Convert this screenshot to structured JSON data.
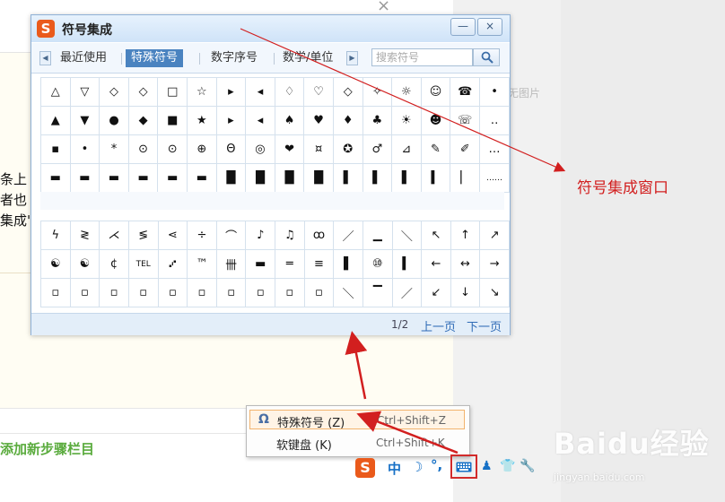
{
  "background": {
    "lines": [
      "条上",
      "者也",
      "集成\""
    ],
    "no_image": "无图片",
    "add_step": "添加新步骤栏目",
    "close_glyph": "×"
  },
  "window": {
    "title": "符号集成",
    "logo_glyph": "S",
    "minimize_glyph": "—",
    "close_glyph": "×",
    "tabs": [
      "最近使用",
      "特殊符号",
      "数字序号",
      "数学/单位"
    ],
    "active_tab": "特殊符号",
    "search_placeholder": "搜索符号",
    "grid_a": [
      [
        "△",
        "▽",
        "◇",
        "◇",
        "□",
        "☆",
        "▸",
        "◂",
        "♢",
        "♡",
        "◇",
        "✧",
        "☼",
        "☺",
        "☎",
        "•"
      ],
      [
        "▲",
        "▼",
        "●",
        "◆",
        "■",
        "★",
        "▸",
        "◂",
        "♠",
        "♥",
        "♦",
        "♣",
        "☀",
        "☻",
        "☏",
        "‥"
      ],
      [
        "▪",
        "•",
        "*",
        "⊙",
        "⊙",
        "⊕",
        "Θ",
        "◎",
        "❤",
        "¤",
        "✪",
        "♂",
        "⊿",
        "✎",
        "✐",
        "…"
      ],
      [
        "▬",
        "▬",
        "▬",
        "▬",
        "▬",
        "▬",
        "█",
        "█",
        "█",
        "█",
        "▌",
        "▌",
        "▌",
        "▍",
        "▏",
        "……"
      ]
    ],
    "grid_b": [
      [
        "ϟ",
        "≷",
        "⋌",
        "≶",
        "⋖",
        "÷",
        "⌒",
        "♪",
        "♫",
        "ꝏ",
        "／",
        "▁",
        "＼",
        "↖",
        "↑",
        "↗"
      ],
      [
        "☯",
        "☯",
        "¢",
        "TEL",
        "⑇",
        "™",
        "卌",
        "▬",
        "═",
        "≡",
        "▌",
        "⑩",
        "▍",
        "←",
        "↔",
        "→"
      ],
      [
        "▫",
        "▫",
        "▫",
        "▫",
        "▫",
        "▫",
        "▫",
        "▫",
        "▫",
        "▫",
        "＼",
        "▔",
        "／",
        "↙",
        "↓",
        "↘"
      ]
    ],
    "page_indicator": "1/2",
    "prev_page": "上一页",
    "next_page": "下一页"
  },
  "popup_menu": {
    "items": [
      {
        "icon": "Ω",
        "label": "特殊符号 (Z)",
        "shortcut": "Ctrl+Shift+Z"
      },
      {
        "icon": "",
        "label": "软键盘 (K)",
        "shortcut": "Ctrl+Shift+K"
      }
    ]
  },
  "ime_bar": {
    "logo": "S",
    "mode": "中",
    "moon": "☽",
    "punct": "°,",
    "user": "♟",
    "skin": "👕",
    "tool": "🔧"
  },
  "annotation": {
    "label": "符号集成窗口",
    "color": "#d21f1f"
  },
  "watermark": {
    "brand": "Baidu经验",
    "url": "jingyan.baidu.com"
  }
}
